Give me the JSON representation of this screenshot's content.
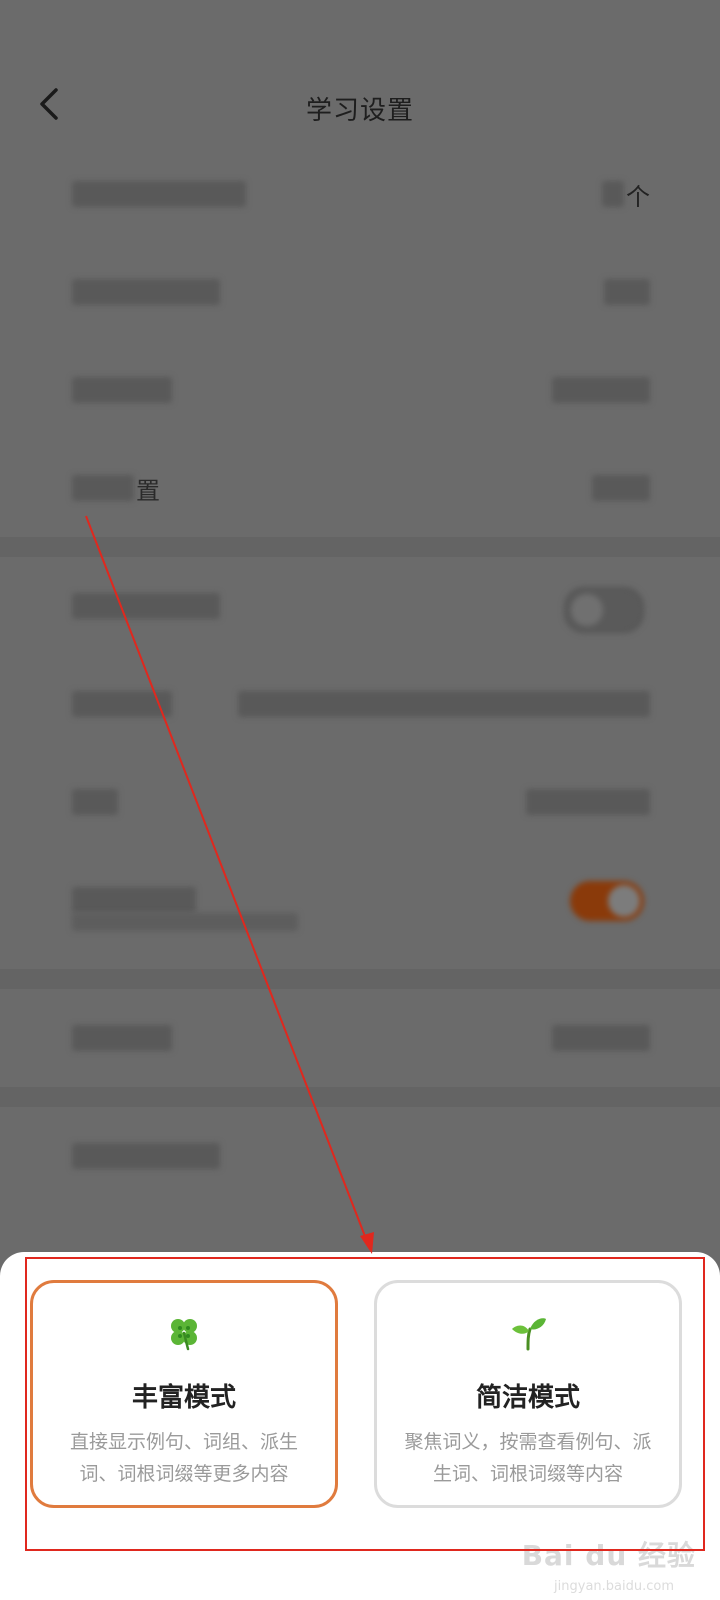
{
  "header": {
    "title": "学习设置"
  },
  "settings": {
    "row1_unit": "个",
    "row4_fragment": "置"
  },
  "modes": {
    "rich": {
      "icon": "clover-icon",
      "name": "丰富模式",
      "description": "直接显示例句、词组、派生词、词根词缀等更多内容"
    },
    "simple": {
      "icon": "sprout-icon",
      "name": "简洁模式",
      "description": "聚焦词义，按需查看例句、派生词、词根词缀等内容"
    }
  },
  "watermark": {
    "brand": "Bai du 经验",
    "url": "jingyan.baidu.com"
  },
  "colors": {
    "overlay": "#6b6b6b",
    "selected_border": "#e07b3e",
    "annotation": "#e0281e"
  }
}
